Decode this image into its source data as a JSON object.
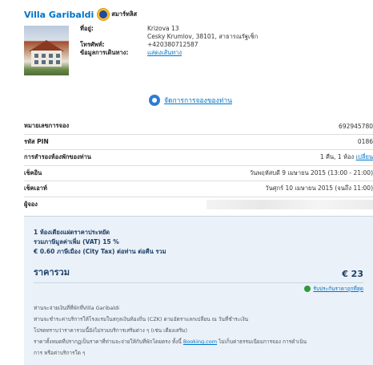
{
  "hotel": {
    "name": "Villa Garibaldi",
    "badge_label": "สมาร์ทลิส",
    "address_label": "ที่อยู่:",
    "address_line1": "Krizova 13",
    "address_line2": "Cesky Krumlov, 38101, สาธารณรัฐเช็ก",
    "phone_label": "โทรศัพท์:",
    "phone": "+420380712587",
    "directions_label": "ข้อมูลการเดินทาง:",
    "directions_link": "แสดงเส้นทาง"
  },
  "manage": {
    "link": "จัดการการจองของท่าน"
  },
  "details": {
    "booking_number_label": "หมายเลขการจอง",
    "booking_number": "692945780",
    "pin_label": "รหัส PIN",
    "pin": "0186",
    "reservation_label": "การสำรองห้องพักของท่าน",
    "reservation_value": "1 คืน, 1 ห้อง",
    "reservation_change": "เปลี่ยน",
    "checkin_label": "เช็คอิน",
    "checkin_value": "วันพฤหัสบดี 9 เมษายน 2015 (13:00 - 21:00)",
    "checkout_label": "เช็คเอาท์",
    "checkout_value": "วันศุกร์ 10 เมษายน 2015 (จนถึง 11:00)",
    "booker_label": "ผู้จอง"
  },
  "price": {
    "room_line": "1 ห้องเตียงแฝดราคาประหยัด",
    "vat_line": "รวมภาษีมูลค่าเพิ่ม (VAT) 15 %",
    "city_tax_line": "€ 0.60 ภาษีเมือง (City Tax) ต่อท่าน ต่อคืน รวม",
    "total_label": "ราคารวม",
    "total_amount": "€ 23",
    "best_price_link": "รับประกันราคาถูกที่สุด",
    "notes": [
      "ท่านจะจ่ายเงินที่ที่พักที่Villa Garibaldi",
      "ท่านจะชำระค่าบริการให้โรงแรมในสกุลเงินท้องถิ่น (CZK) ตามอัตราแลกเปลี่ยน ณ วันที่ชำระเงิน",
      "โปรดทราบว่าราคารวมนี้ยังไม่รวมบริการเสริมต่าง ๆ (เช่น เตียงเสริม)",
      "ราคาทั้งหมดที่ปรากฏเป็นราคาที่ท่านจะจ่ายให้กับที่พักโดยตรง ทั้งนี้",
      "การ หรือค่าบริการใด ๆ"
    ],
    "notes_booking_link": "Booking.com",
    "notes_tail": "ไม่เก็บค่าธรรมเนียมการจอง การดำเนิน"
  }
}
